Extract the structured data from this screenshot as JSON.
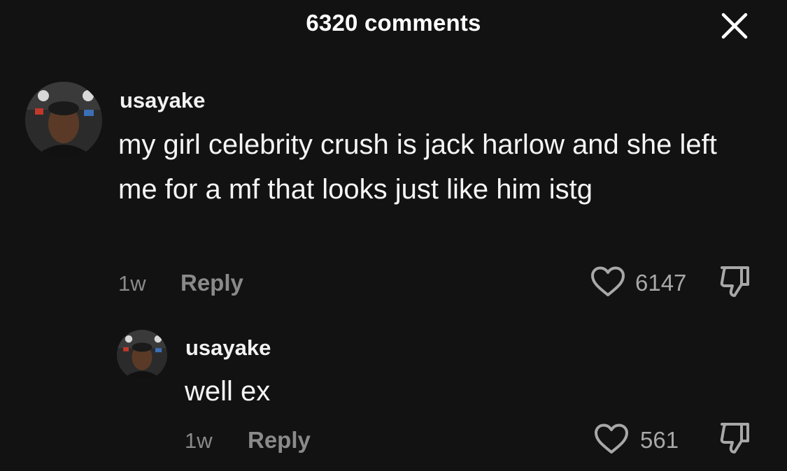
{
  "header": {
    "title": "6320 comments"
  },
  "comments": [
    {
      "username": "usayake",
      "text": "my girl celebrity crush is jack harlow and she left me for a mf that looks just like him istg",
      "time": "1w",
      "reply_label": "Reply",
      "likes": "6147"
    }
  ],
  "replies": [
    {
      "username": "usayake",
      "text": "well ex",
      "time": "1w",
      "reply_label": "Reply",
      "likes": "561"
    }
  ],
  "icons": {
    "close": "close-icon",
    "like": "heart-outline-icon",
    "dislike": "thumbs-down-icon"
  },
  "colors": {
    "background": "#121212",
    "primary_text": "#ffffff",
    "secondary_text": "#8a8a8a"
  }
}
